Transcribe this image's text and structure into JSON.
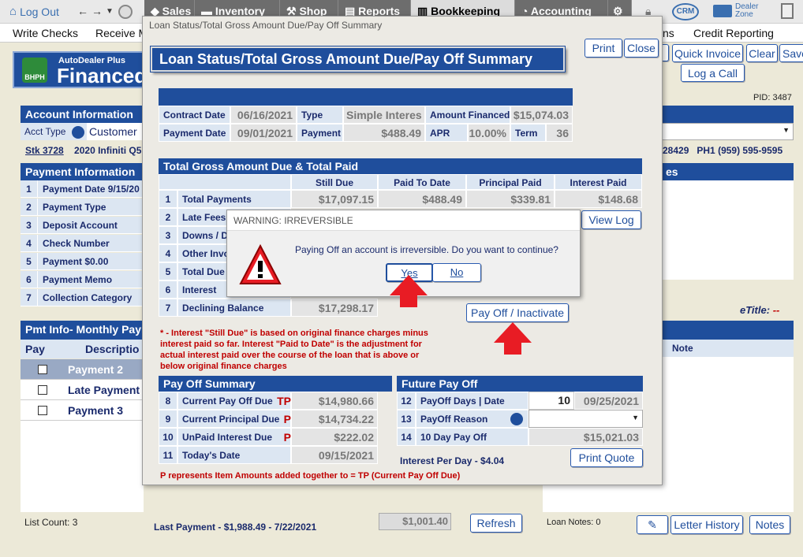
{
  "topnav": {
    "logout": "Log Out",
    "tabs": [
      "Sales",
      "Inventory",
      "Shop",
      "Reports",
      "Bookkeeping",
      "Accounting"
    ],
    "active_tab": "Bookkeeping",
    "crm": "CRM",
    "dealer_zone": "Dealer Zone"
  },
  "submenu": {
    "items": [
      "Write Checks",
      "Receive M",
      "ns",
      "Credit Reporting"
    ]
  },
  "logo": {
    "line1": "AutoDealer Plus",
    "line2": "Financed",
    "badge": "BHPH"
  },
  "account_info": {
    "header": "Account Information",
    "acct_type_label": "Acct Type",
    "acct_type_value": "Customer",
    "stock": "Stk 3728",
    "vehicle": "2020 Infiniti Q5",
    "zip_partial": "28429",
    "phone": "PH1 (959) 595-9595",
    "pid": "PID: 3487"
  },
  "payment_info": {
    "header": "Payment Information",
    "rows": [
      {
        "n": "1",
        "label": "Payment Date  9/15/20"
      },
      {
        "n": "2",
        "label": "Payment Type"
      },
      {
        "n": "3",
        "label": "Deposit Account"
      },
      {
        "n": "4",
        "label": "Check Number"
      },
      {
        "n": "5",
        "label": "Payment  $0.00"
      },
      {
        "n": "6",
        "label": "Payment Memo"
      },
      {
        "n": "7",
        "label": "Collection Category"
      }
    ]
  },
  "pmt_info": {
    "header": "Pmt Info- Monthly Paym",
    "col_pay": "Pay",
    "col_desc": "Descriptio",
    "rows": [
      "Payment 2",
      "Late Payment",
      "Payment 3"
    ],
    "list_count": "List Count:  3",
    "last_payment": "Last Payment - $1,988.49 - 7/22/2021",
    "amount_box": "$1,001.40"
  },
  "right_panel": {
    "notes_header_partial": "es",
    "etitle_label": "eTitle:",
    "etitle_value": "--",
    "note_col": "Note",
    "loan_notes": "Loan Notes:  0"
  },
  "bg_buttons": {
    "quick_invoice": "Quick Invoice",
    "clear": "Clear",
    "save": "Save",
    "log_a_call": "Log a Call",
    "refresh": "Refresh",
    "letter_history": "Letter History",
    "notes": "Notes"
  },
  "dialog": {
    "window_title": "Loan Status/Total Gross Amount Due/Pay Off Summary",
    "heading": "Loan Status/Total Gross Amount Due/Pay Off Summary",
    "print": "Print",
    "close": "Close",
    "contract": {
      "contract_date_label": "Contract Date",
      "contract_date": "06/16/2021",
      "type_label": "Type",
      "type": "Simple Interes",
      "amount_financed_label": "Amount Financed",
      "amount_financed": "$15,074.03",
      "payment_date_label": "Payment Date",
      "payment_date": "09/01/2021",
      "payment_label": "Payment",
      "payment": "$488.49",
      "apr_label": "APR",
      "apr": "10.00%",
      "term_label": "Term",
      "term": "36"
    },
    "totals": {
      "header": "Total Gross Amount Due & Total Paid",
      "columns": [
        "Still Due",
        "Paid To Date",
        "Principal Paid",
        "Interest Paid"
      ],
      "rows": [
        {
          "n": "1",
          "label": "Total Payments",
          "still_due": "$17,097.15",
          "paid": "$488.49",
          "principal": "$339.81",
          "interest": "$148.68"
        },
        {
          "n": "2",
          "label": "Late Fees"
        },
        {
          "n": "3",
          "label": "Downs / De"
        },
        {
          "n": "4",
          "label": "Other Invo"
        },
        {
          "n": "5",
          "label": "Total Due"
        },
        {
          "n": "6",
          "label": "Interest"
        },
        {
          "n": "7",
          "label": "Declining Balance",
          "still_due": "$17,298.17"
        }
      ],
      "view_log": "View Log",
      "payoff_inactivate": "Pay Off / Inactivate"
    },
    "footnote": "* - Interest \"Still Due\" is based on original finance charges minus interest paid so far. Interest \"Paid to Date\" is the adjustment for actual interest paid over the course of the loan that is above or below original finance charges",
    "payoff_summary": {
      "header": "Pay Off Summary",
      "rows": [
        {
          "n": "8",
          "label": "Current Pay Off Due",
          "flag": "TP",
          "value": "$14,980.66"
        },
        {
          "n": "9",
          "label": "Current Principal Due",
          "flag": "P",
          "value": "$14,734.22"
        },
        {
          "n": "10",
          "label": "UnPaid Interest Due",
          "flag": "P",
          "value": "$222.02"
        },
        {
          "n": "11",
          "label": "Today's Date",
          "flag": "",
          "value": "09/15/2021"
        }
      ]
    },
    "future_payoff": {
      "header": "Future Pay Off",
      "days_label": "PayOff Days | Date",
      "days": "10",
      "date": "09/25/2021",
      "reason_label": "PayOff Reason",
      "ten_day_label": "10 Day Pay Off",
      "ten_day_value": "$15,021.03",
      "interest_per_day": "Interest Per Day - $4.04",
      "print_quote": "Print Quote",
      "n12": "12",
      "n13": "13",
      "n14": "14"
    },
    "tp_note": "P represents Item Amounts added together to = TP (Current Pay Off Due)"
  },
  "warning": {
    "title": "WARNING: IRREVERSIBLE",
    "message": "Paying Off an account is irreversible. Do you want to continue?",
    "yes": "Yes",
    "no": "No"
  },
  "colors": {
    "accent": "#1f4e9c",
    "alert": "#c00000",
    "arrow": "#e81c24"
  }
}
